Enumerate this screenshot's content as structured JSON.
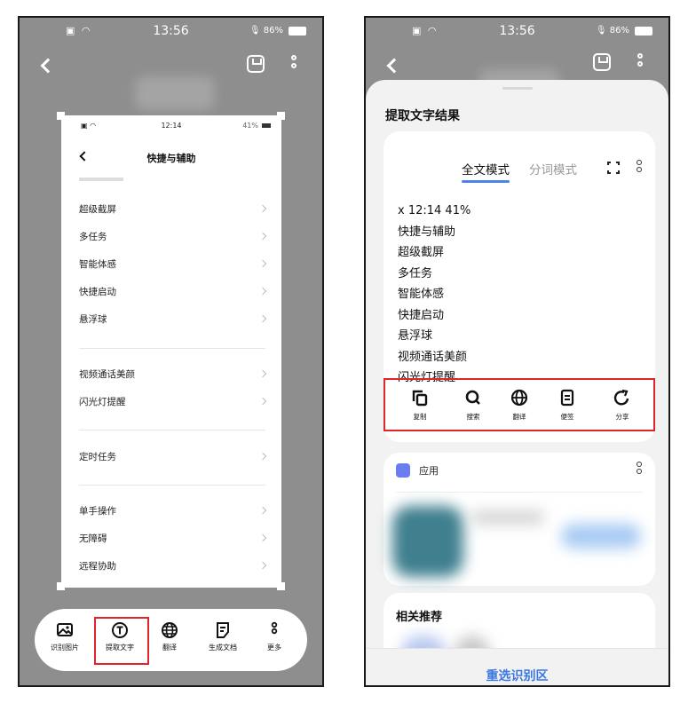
{
  "left_phone": {
    "status": {
      "time": "13:56",
      "battery": "86%"
    },
    "inner_screenshot": {
      "status": {
        "time": "12:14",
        "battery": "41%"
      },
      "title": "快捷与辅助",
      "rows": [
        "超级截屏",
        "多任务",
        "智能体感",
        "快捷启动",
        "悬浮球",
        "视频通话美颜",
        "闪光灯提醒",
        "定时任务",
        "单手操作",
        "无障碍",
        "远程协助"
      ]
    },
    "toolbar": [
      {
        "label": "识别图片",
        "icon": "image-scan-icon"
      },
      {
        "label": "提取文字",
        "icon": "text-extract-icon"
      },
      {
        "label": "翻译",
        "icon": "globe-icon"
      },
      {
        "label": "生成文档",
        "icon": "document-icon"
      },
      {
        "label": "更多",
        "icon": "more-icon"
      }
    ]
  },
  "right_phone": {
    "status": {
      "time": "13:56",
      "battery": "86%"
    },
    "sheet": {
      "title": "提取文字结果",
      "tab_full": "全文模式",
      "tab_word": "分词模式",
      "lines": [
        "x 12:14 41%",
        "快捷与辅助",
        "超级截屏",
        "多任务",
        "智能体感",
        "快捷启动",
        "悬浮球",
        "视频通话美颜",
        "闪光灯提醒"
      ],
      "actions": [
        {
          "label": "复制",
          "icon": "copy-icon"
        },
        {
          "label": "搜索",
          "icon": "search-icon"
        },
        {
          "label": "翻译",
          "icon": "globe-icon"
        },
        {
          "label": "便签",
          "icon": "note-icon"
        },
        {
          "label": "分享",
          "icon": "share-icon"
        }
      ],
      "app_section": "应用",
      "recommend_title": "相关推荐",
      "reselect": "重选识别区"
    }
  },
  "colors": {
    "highlight": "#e0242b",
    "accent": "#3a78e0",
    "backdrop": "#8e8e8e"
  }
}
